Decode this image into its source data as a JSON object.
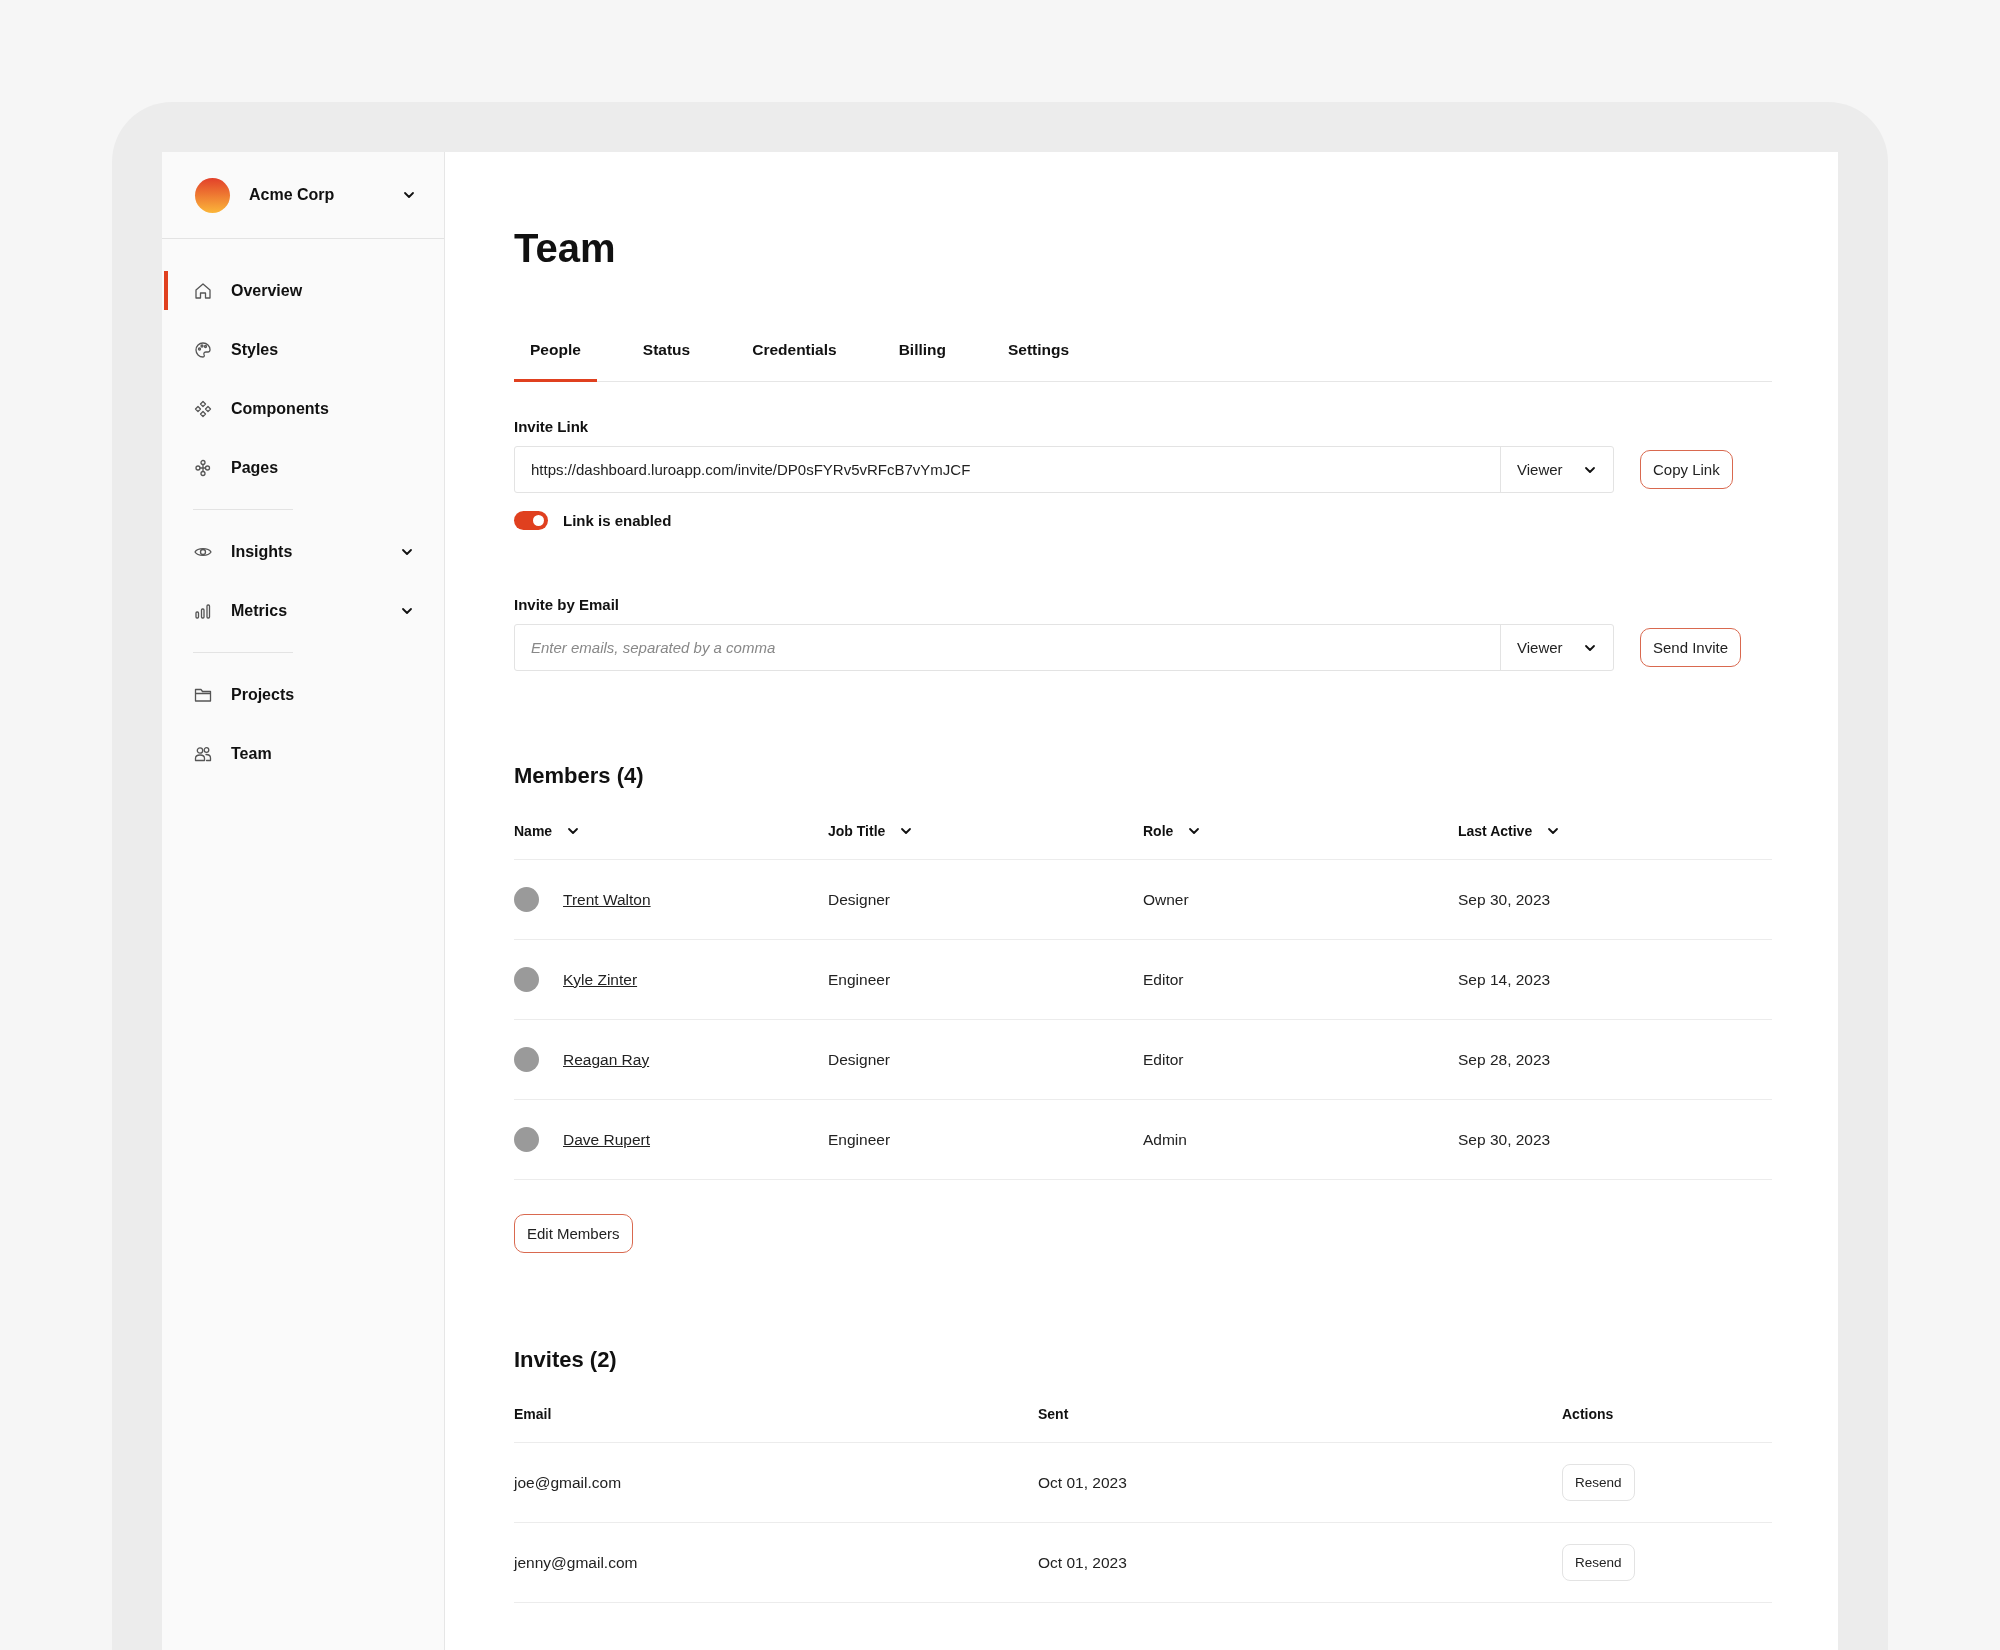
{
  "workspace": {
    "name": "Acme Corp"
  },
  "sidebar": {
    "groups": [
      [
        {
          "label": "Overview",
          "selected": true,
          "has_children": false
        },
        {
          "label": "Styles",
          "selected": false,
          "has_children": false
        },
        {
          "label": "Components",
          "selected": false,
          "has_children": false
        },
        {
          "label": "Pages",
          "selected": false,
          "has_children": false
        }
      ],
      [
        {
          "label": "Insights",
          "selected": false,
          "has_children": true
        },
        {
          "label": "Metrics",
          "selected": false,
          "has_children": true
        }
      ],
      [
        {
          "label": "Projects",
          "selected": false,
          "has_children": false
        },
        {
          "label": "Team",
          "selected": false,
          "has_children": false
        }
      ]
    ]
  },
  "page": {
    "title": "Team"
  },
  "tabs": [
    {
      "label": "People",
      "selected": true
    },
    {
      "label": "Status",
      "selected": false
    },
    {
      "label": "Credentials",
      "selected": false
    },
    {
      "label": "Billing",
      "selected": false
    },
    {
      "label": "Settings",
      "selected": false
    }
  ],
  "invite_link": {
    "label": "Invite Link",
    "value": "https://dashboard.luroapp.com/invite/DP0sFYRv5vRFcB7vYmJCF",
    "role": "Viewer",
    "button": "Copy Link",
    "toggle": {
      "label": "Link is enabled",
      "on": true
    }
  },
  "invite_email": {
    "label": "Invite by Email",
    "placeholder": "Enter emails, separated by a comma",
    "role": "Viewer",
    "button": "Send Invite"
  },
  "members": {
    "title": "Members (4)",
    "columns": [
      "Name",
      "Job Title",
      "Role",
      "Last Active"
    ],
    "rows": [
      {
        "name": "Trent Walton",
        "job_title": "Designer",
        "role": "Owner",
        "last_active": "Sep 30, 2023"
      },
      {
        "name": "Kyle Zinter",
        "job_title": "Engineer",
        "role": "Editor",
        "last_active": "Sep 14, 2023"
      },
      {
        "name": "Reagan Ray",
        "job_title": "Designer",
        "role": "Editor",
        "last_active": "Sep 28, 2023"
      },
      {
        "name": "Dave Rupert",
        "job_title": "Engineer",
        "role": "Admin",
        "last_active": "Sep 30, 2023"
      }
    ],
    "button": "Edit Members"
  },
  "invites": {
    "title": "Invites (2)",
    "columns": [
      "Email",
      "Sent",
      "Actions"
    ],
    "rows": [
      {
        "email": "joe@gmail.com",
        "sent": "Oct 01, 2023",
        "action": "Resend"
      },
      {
        "email": "jenny@gmail.com",
        "sent": "Oct 01, 2023",
        "action": "Resend"
      }
    ]
  }
}
